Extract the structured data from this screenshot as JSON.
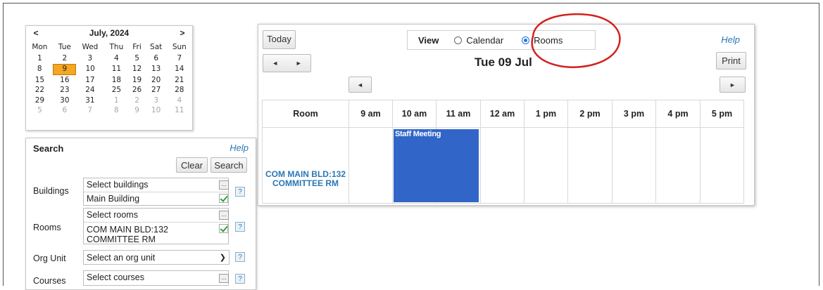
{
  "mini_calendar": {
    "prev": "<",
    "next": ">",
    "month_title": "July, 2024",
    "weekdays": [
      "Mon",
      "Tue",
      "Wed",
      "Thu",
      "Fri",
      "Sat",
      "Sun"
    ],
    "weeks": [
      [
        "1",
        "2",
        "3",
        "4",
        "5",
        "6",
        "7"
      ],
      [
        "8",
        "9",
        "10",
        "11",
        "12",
        "13",
        "14"
      ],
      [
        "15",
        "16",
        "17",
        "18",
        "19",
        "20",
        "21"
      ],
      [
        "22",
        "23",
        "24",
        "25",
        "26",
        "27",
        "28"
      ],
      [
        "29",
        "30",
        "31",
        "1",
        "2",
        "3",
        "4"
      ],
      [
        "5",
        "6",
        "7",
        "8",
        "9",
        "10",
        "11"
      ]
    ],
    "selected_day": "9",
    "accent": "#f5a623"
  },
  "search": {
    "title": "Search",
    "help": "Help",
    "clear_label": "Clear",
    "search_label": "Search",
    "buildings": {
      "label": "Buildings",
      "placeholder": "Select buildings",
      "value": "Main Building"
    },
    "rooms": {
      "label": "Rooms",
      "placeholder": "Select rooms",
      "value_line1": "COM MAIN BLD:132",
      "value_line2": "COMMITTEE RM"
    },
    "org_unit": {
      "label": "Org Unit",
      "value": "Select an org unit"
    },
    "courses": {
      "label": "Courses",
      "value": "Select courses"
    },
    "ellipsis": "...",
    "qmark": "?"
  },
  "schedule": {
    "today_label": "Today",
    "prev_arrow": "◄",
    "next_arrow": "►",
    "view_label": "View",
    "view_options": [
      {
        "label": "Calendar",
        "selected": false
      },
      {
        "label": "Rooms",
        "selected": true
      }
    ],
    "help": "Help",
    "print_label": "Print",
    "date_title": "Tue 09 Jul",
    "columns": [
      "Room",
      "9 am",
      "10 am",
      "11 am",
      "12 am",
      "1 pm",
      "2 pm",
      "3 pm",
      "4 pm",
      "5 pm"
    ],
    "room_name_line1": "COM MAIN BLD:132",
    "room_name_line2": "COMMITTEE RM",
    "event": {
      "title": "Staff Meeting",
      "color": "#3166c8"
    },
    "annotation_color": "#d42020"
  }
}
